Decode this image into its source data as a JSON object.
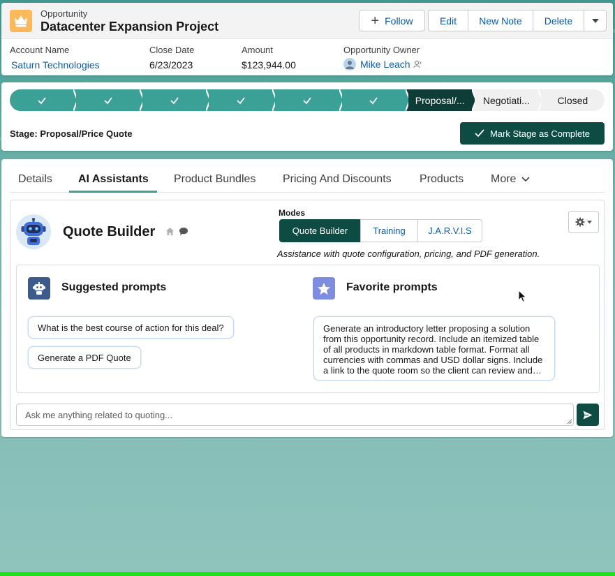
{
  "header": {
    "object_label": "Opportunity",
    "record_title": "Datacenter Expansion Project",
    "icon": "crown-icon",
    "buttons": {
      "follow": "Follow",
      "edit": "Edit",
      "new_note": "New Note",
      "delete": "Delete"
    }
  },
  "fields": {
    "account_name": {
      "label": "Account Name",
      "value": "Saturn Technologies"
    },
    "close_date": {
      "label": "Close Date",
      "value": "6/23/2023"
    },
    "amount": {
      "label": "Amount",
      "value": "$123,944.00"
    },
    "owner": {
      "label": "Opportunity Owner",
      "value": "Mike Leach"
    }
  },
  "path": {
    "stages": [
      {
        "status": "complete"
      },
      {
        "status": "complete"
      },
      {
        "status": "complete"
      },
      {
        "status": "complete"
      },
      {
        "status": "complete"
      },
      {
        "status": "complete"
      },
      {
        "label": "Proposal/...",
        "status": "current"
      },
      {
        "label": "Negotiati...",
        "status": "incomplete"
      },
      {
        "label": "Closed",
        "status": "incomplete"
      }
    ],
    "stage_text": "Stage: Proposal/Price Quote",
    "mark_complete": "Mark Stage as Complete"
  },
  "tabs": [
    {
      "label": "Details",
      "active": false
    },
    {
      "label": "AI Assistants",
      "active": true
    },
    {
      "label": "Product Bundles",
      "active": false
    },
    {
      "label": "Pricing And Discounts",
      "active": false
    },
    {
      "label": "Products",
      "active": false
    }
  ],
  "more_tab": "More",
  "assistant": {
    "title": "Quote Builder",
    "modes_label": "Modes",
    "modes": [
      {
        "label": "Quote Builder",
        "active": true
      },
      {
        "label": "Training",
        "active": false
      },
      {
        "label": "J.A.R.V.I.S",
        "active": false
      }
    ],
    "modes_description": "Assistance with quote configuration, pricing, and PDF generation.",
    "suggested_title": "Suggested prompts",
    "suggested": [
      "What is the best course of action for this deal?",
      "Generate a PDF Quote"
    ],
    "favorite_title": "Favorite prompts",
    "favorite": "Generate an introductory letter proposing a solution from this opportunity record. Include an itemized table of all products in markdown table format. Format all currencies with commas and USD dollar signs. Include a link to the quote room so the client can review and approve the quote online.",
    "input_placeholder": "Ask me anything related to quoting..."
  },
  "colors": {
    "accent": "#3ba095",
    "accent_dark": "#0d4b43",
    "link": "#0b5cab",
    "opportunity_icon": "#fcb95b",
    "favorite_icon": "#7f8de1"
  }
}
